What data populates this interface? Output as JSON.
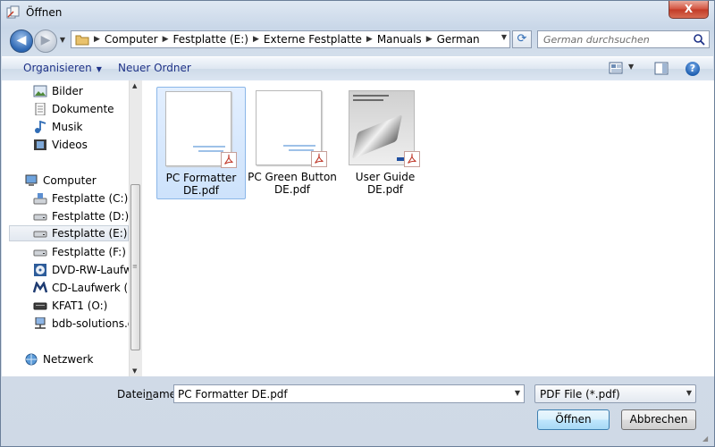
{
  "window": {
    "title": "Öffnen",
    "close_label": "X"
  },
  "address": {
    "breadcrumbs": [
      "Computer",
      "Festplatte (E:)",
      "Externe Festplatte",
      "Manuals",
      "German"
    ],
    "search_placeholder": "German durchsuchen"
  },
  "toolbar": {
    "organize_label": "Organisieren",
    "new_folder_label": "Neuer Ordner"
  },
  "nav_pane": {
    "items": [
      {
        "label": "Bilder",
        "icon": "pictures-icon"
      },
      {
        "label": "Dokumente",
        "icon": "documents-icon"
      },
      {
        "label": "Musik",
        "icon": "music-icon"
      },
      {
        "label": "Videos",
        "icon": "videos-icon"
      },
      {
        "label": "Computer",
        "icon": "computer-icon"
      },
      {
        "label": "Festplatte (C:)",
        "icon": "system-drive-icon"
      },
      {
        "label": "Festplatte (D:)",
        "icon": "drive-icon"
      },
      {
        "label": "Festplatte (E:)",
        "icon": "drive-icon",
        "selected": true
      },
      {
        "label": "Festplatte (F:)",
        "icon": "drive-icon"
      },
      {
        "label": "DVD-RW-Laufwerk",
        "icon": "dvd-drive-icon"
      },
      {
        "label": "CD-Laufwerk (M:",
        "icon": "cd-drive-icon"
      },
      {
        "label": "KFAT1 (O:)",
        "icon": "drive-icon"
      },
      {
        "label": "bdb-solutions.de",
        "icon": "network-drive-icon"
      },
      {
        "label": "Netzwerk",
        "icon": "network-icon"
      }
    ]
  },
  "files": [
    {
      "name_line1": "PC Formatter",
      "name_line2": "DE.pdf",
      "selected": true
    },
    {
      "name_line1": "PC Green Button",
      "name_line2": "DE.pdf",
      "selected": false
    },
    {
      "name_line1": "User Guide",
      "name_line2": "DE.pdf",
      "selected": false
    }
  ],
  "footer": {
    "filename_label_pre": "Datei",
    "filename_label_accel": "n",
    "filename_label_post": "ame:",
    "filename_value": "PC Formatter DE.pdf",
    "filetype_value": "PDF File (*.pdf)",
    "open_label": "Öffnen",
    "cancel_label": "Abbrechen"
  },
  "colors": {
    "accent": "#1e3287",
    "selection": "#cde2fb",
    "close": "#c23a26"
  }
}
